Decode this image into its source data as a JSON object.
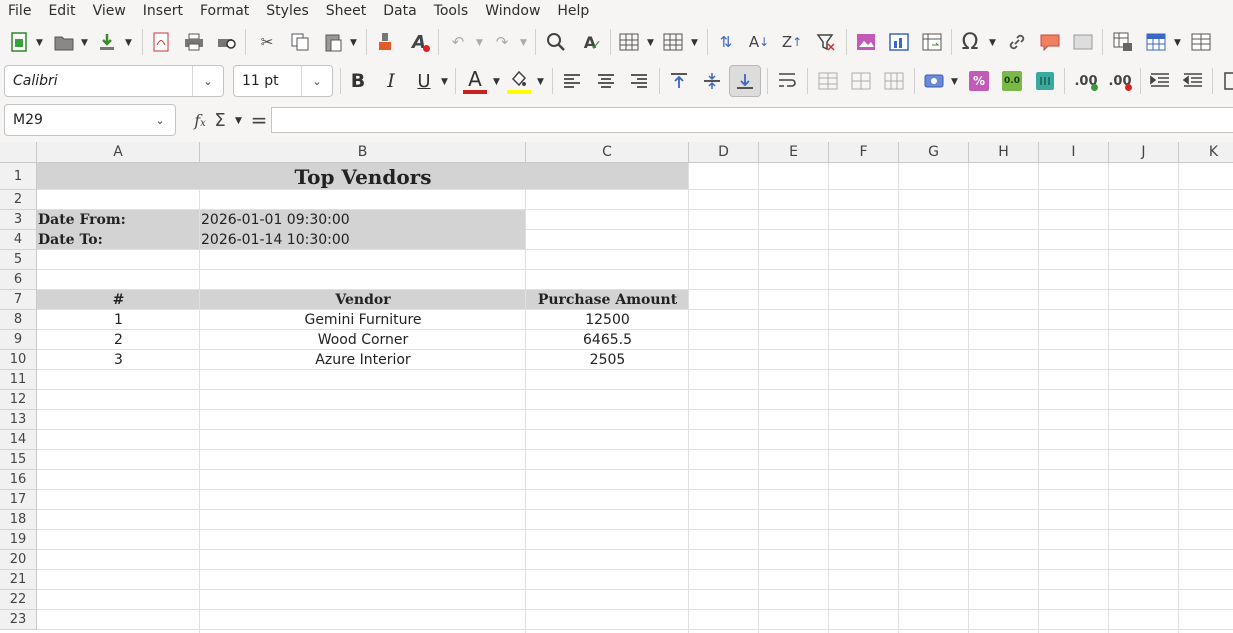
{
  "menu": [
    "File",
    "Edit",
    "View",
    "Insert",
    "Format",
    "Styles",
    "Sheet",
    "Data",
    "Tools",
    "Window",
    "Help"
  ],
  "toolbar": {
    "font_name": "Calibri",
    "font_size": "11 pt",
    "bold": "B",
    "italic": "I",
    "underline": "U",
    "font_color_glyph": "A",
    "sort_az": "A",
    "sort_za": "Z",
    "special_char": "Ω",
    "pct": "%",
    "num_zero": "0.0",
    "dec_add": ".00",
    "dec_del": ".00",
    "font_color_hex": "#cc1f1f",
    "highlight_hex": "#ffff00"
  },
  "formula_bar": {
    "cell_ref": "M29",
    "fx": "f",
    "sum": "Σ",
    "eq": "=",
    "content": ""
  },
  "columns": [
    "A",
    "B",
    "C",
    "D",
    "E",
    "F",
    "G",
    "H",
    "I",
    "J",
    "K"
  ],
  "rows": [
    "1",
    "2",
    "3",
    "4",
    "5",
    "6",
    "7",
    "8",
    "9",
    "10",
    "11",
    "12",
    "13",
    "14",
    "15",
    "16",
    "17",
    "18",
    "19",
    "20",
    "21",
    "22",
    "23"
  ],
  "sheet": {
    "title": "Top Vendors",
    "date_from_label": "Date From:",
    "date_from_value": "2026-01-01 09:30:00",
    "date_to_label": "Date To:",
    "date_to_value": "2026-01-14 10:30:00",
    "headers": [
      "#",
      "Vendor",
      "Purchase Amount"
    ],
    "data": [
      [
        "1",
        "Gemini Furniture",
        "12500"
      ],
      [
        "2",
        "Wood Corner",
        "6465.5"
      ],
      [
        "3",
        "Azure Interior",
        "2505"
      ]
    ]
  }
}
